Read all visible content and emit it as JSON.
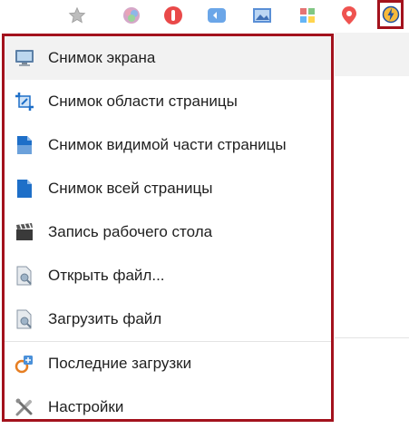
{
  "toolbar": {
    "icons": [
      "star-icon",
      "colorful-extension-icon",
      "red-extension-icon",
      "blue-extension-icon",
      "image-extension-icon",
      "puzzle-extension-icon",
      "map-pin-extension-icon",
      "screenshot-extension-icon"
    ]
  },
  "menu": {
    "items": [
      {
        "label": "Снимок экрана",
        "icon": "monitor-icon"
      },
      {
        "label": "Снимок области страницы",
        "icon": "crop-icon"
      },
      {
        "label": "Снимок видимой части страницы",
        "icon": "visible-page-icon"
      },
      {
        "label": "Снимок всей страницы",
        "icon": "full-page-icon"
      },
      {
        "label": "Запись рабочего стола",
        "icon": "clapperboard-icon"
      },
      {
        "label": "Открыть файл...",
        "icon": "open-file-icon"
      },
      {
        "label": "Загрузить файл",
        "icon": "upload-file-icon"
      },
      {
        "label": "Последние загрузки",
        "icon": "recent-uploads-icon"
      },
      {
        "label": "Настройки",
        "icon": "settings-tools-icon"
      }
    ]
  },
  "colors": {
    "highlight_border": "#a3121d",
    "active_row": "#f2f2f2",
    "text": "#1f1f1f"
  }
}
